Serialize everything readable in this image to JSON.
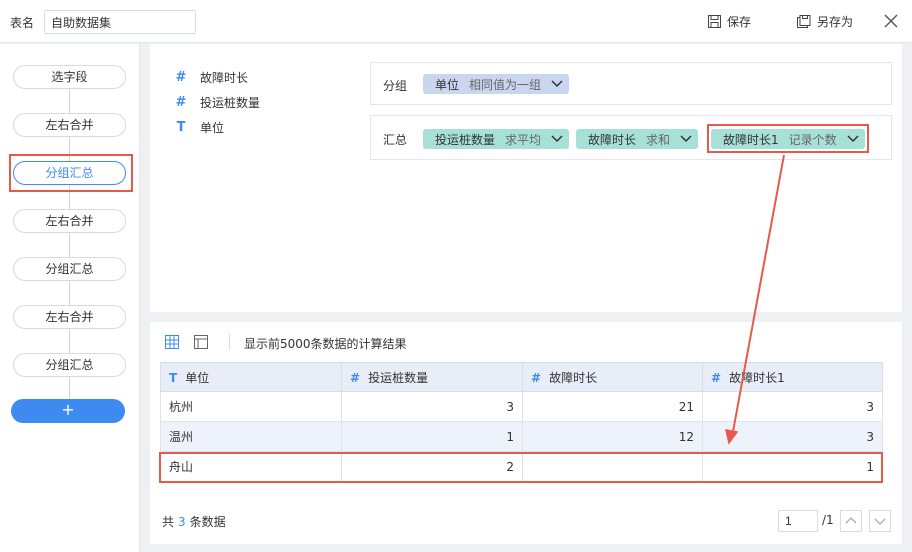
{
  "header": {
    "table_name_label": "表名",
    "table_name_value": "自助数据集",
    "save_label": "保存",
    "save_as_label": "另存为"
  },
  "steps": [
    {
      "label": "选字段"
    },
    {
      "label": "左右合并"
    },
    {
      "label": "分组汇总"
    },
    {
      "label": "左右合并"
    },
    {
      "label": "分组汇总"
    },
    {
      "label": "左右合并"
    },
    {
      "label": "分组汇总"
    }
  ],
  "active_step_index": 2,
  "add_step_label": "+",
  "fields": [
    {
      "type_icon": "#",
      "name": "故障时长"
    },
    {
      "type_icon": "#",
      "name": "投运桩数量"
    },
    {
      "type_icon": "T",
      "name": "单位"
    }
  ],
  "group_zone": {
    "label": "分组",
    "chips": [
      {
        "name": "单位",
        "mode": "相同值为一组"
      }
    ]
  },
  "summary_zone": {
    "label": "汇总",
    "chips": [
      {
        "name": "投运桩数量",
        "mode": "求平均"
      },
      {
        "name": "故障时长",
        "mode": "求和"
      },
      {
        "name": "故障时长1",
        "mode": "记录个数"
      }
    ]
  },
  "result": {
    "description": "显示前5000条数据的计算结果",
    "columns": [
      {
        "icon": "T",
        "name": "单位"
      },
      {
        "icon": "#",
        "name": "投运桩数量"
      },
      {
        "icon": "#",
        "name": "故障时长"
      },
      {
        "icon": "#",
        "name": "故障时长1"
      }
    ],
    "rows": [
      [
        "杭州",
        "3",
        "21",
        "3"
      ],
      [
        "温州",
        "1",
        "12",
        "3"
      ],
      [
        "舟山",
        "2",
        "",
        "1"
      ]
    ],
    "total_prefix": "共",
    "total_count": "3",
    "total_suffix": "条数据",
    "page_current": "1",
    "page_total": "/1"
  },
  "colors": {
    "accent": "#3d8bf0",
    "highlight_red": "#e65a4b",
    "chip_blue": "#c9d6ef",
    "chip_teal": "#a6e0d8"
  }
}
